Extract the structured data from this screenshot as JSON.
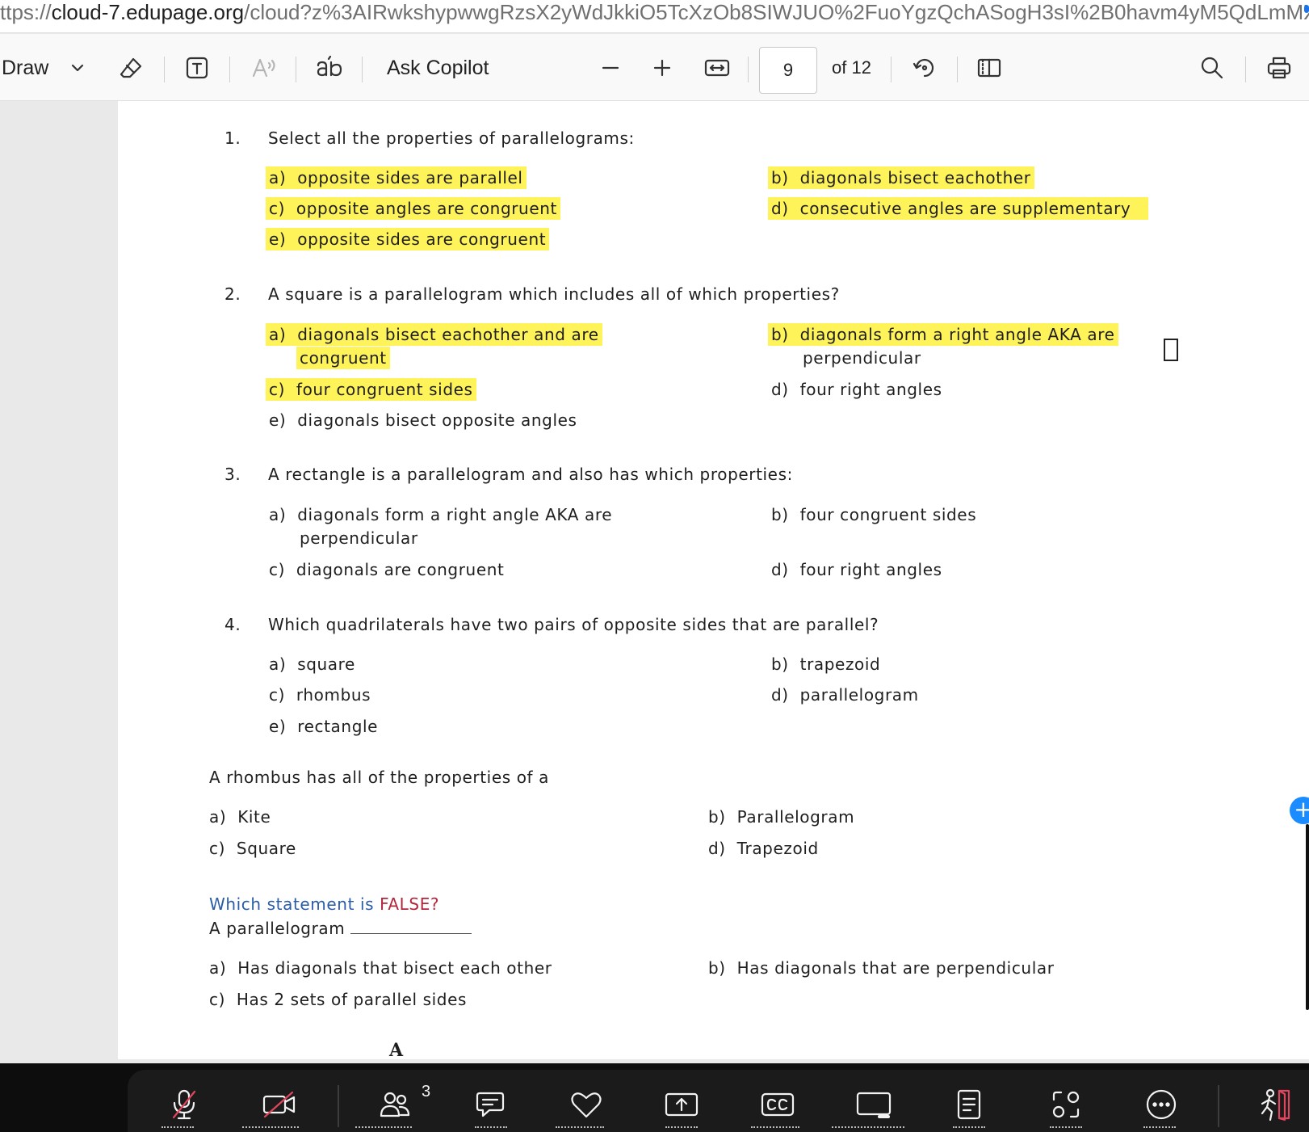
{
  "browser": {
    "url_prefix": "ttps://",
    "url_domain": "cloud-7.edupage.org",
    "url_rest": "/cloud?z%3AIRwkshypwwgRzsX2yWdJkkiO5TcXzOb8SIWJUO%2FuoYgzQchASogH3sI%2B0havm4yM5QdLmMX..."
  },
  "toolbar": {
    "draw_label": "Draw",
    "ask_copilot_label": "Ask Copilot",
    "page_number": "9",
    "page_total": "of 12"
  },
  "questions": [
    {
      "number": "1.",
      "prompt": "Select all the properties of parallelograms:",
      "options": [
        {
          "letter": "a)",
          "text": "opposite sides are parallel",
          "highlighted": true
        },
        {
          "letter": "b)",
          "text": "diagonals bisect eachother",
          "highlighted": true
        },
        {
          "letter": "c)",
          "text": "opposite angles are congruent",
          "highlighted": true
        },
        {
          "letter": "d)",
          "text": "consecutive angles are supplementary",
          "highlighted": true
        },
        {
          "letter": "e)",
          "text": "opposite sides are congruent",
          "highlighted": true
        }
      ]
    },
    {
      "number": "2.",
      "prompt": "A square is a parallelogram which includes all of which properties?",
      "options": [
        {
          "letter": "a)",
          "text": "diagonals bisect eachother and are",
          "text2": "congruent",
          "highlighted": true
        },
        {
          "letter": "b)",
          "text": "diagonals form a right angle AKA are",
          "text2": "perpendicular",
          "highlighted": true
        },
        {
          "letter": "c)",
          "text": "four congruent sides",
          "highlighted": true
        },
        {
          "letter": "d)",
          "text": "four right angles",
          "highlighted": false
        },
        {
          "letter": "e)",
          "text": "diagonals bisect opposite angles",
          "highlighted": false
        }
      ]
    },
    {
      "number": "3.",
      "prompt": "A rectangle is a parallelogram and also has which properties:",
      "options": [
        {
          "letter": "a)",
          "text": "diagonals form a right angle AKA are",
          "text2": "perpendicular"
        },
        {
          "letter": "b)",
          "text": "four congruent sides"
        },
        {
          "letter": "c)",
          "text": "diagonals are congruent"
        },
        {
          "letter": "d)",
          "text": "four right angles"
        }
      ]
    },
    {
      "number": "4.",
      "prompt": "Which quadrilaterals have two pairs of opposite sides that are parallel?",
      "options": [
        {
          "letter": "a)",
          "text": "square"
        },
        {
          "letter": "b)",
          "text": "trapezoid"
        },
        {
          "letter": "c)",
          "text": "rhombus"
        },
        {
          "letter": "d)",
          "text": "parallelogram"
        },
        {
          "letter": "e)",
          "text": "rectangle"
        }
      ]
    }
  ],
  "rhombus_question": {
    "prompt": "A rhombus has all of the properties of a",
    "options": [
      {
        "letter": "a)",
        "text": "Kite"
      },
      {
        "letter": "b)",
        "text": "Parallelogram"
      },
      {
        "letter": "c)",
        "text": "Square"
      },
      {
        "letter": "d)",
        "text": "Trapezoid"
      }
    ]
  },
  "false_question": {
    "heading_prefix": "Which statement is ",
    "heading_emphasis": "FALSE?",
    "stem": "A parallelogram",
    "options": [
      {
        "letter": "a)",
        "text": "Has diagonals that bisect each other"
      },
      {
        "letter": "b)",
        "text": "Has diagonals that are perpendicular"
      },
      {
        "letter": "c)",
        "text": "Has 2 sets of parallel sides"
      }
    ]
  },
  "footer_mark": "A",
  "meeting_bar": {
    "participants_count": "3"
  },
  "colors": {
    "highlight": "#fff35a",
    "link_blue": "#2b5ca8",
    "false_red": "#b3253a",
    "meeting_bar_bg": "#1b1b1b",
    "add_button": "#1a8cff"
  }
}
